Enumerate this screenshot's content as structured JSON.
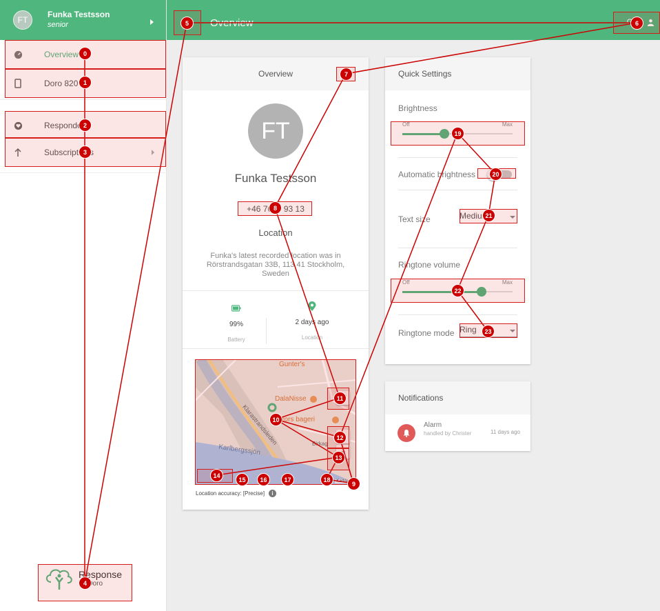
{
  "sidebar": {
    "avatar_initials": "FT",
    "user_name": "Funka Testsson",
    "user_role": "senior",
    "items": [
      {
        "label": "Overview",
        "icon": "dashboard-icon"
      },
      {
        "label": "Doro 820",
        "icon": "phone-icon"
      },
      {
        "label": "Responders",
        "icon": "heart-icon"
      },
      {
        "label": "Subscriptions",
        "icon": "arrow-up-icon"
      }
    ],
    "logo_title": "Response",
    "logo_sub": "by Doro"
  },
  "topbar": {
    "title": "Overview",
    "user_label": "Ch..."
  },
  "overview": {
    "header": "Overview",
    "initials": "FT",
    "name": "Funka Testsson",
    "phone": "+46 76 ... 93 13",
    "location_title": "Location",
    "location_text": "Funka's latest recorded location was in Rörstrandsgatan 33B, 113 41 Stockholm, Sweden",
    "battery_value": "99%",
    "battery_caption": "Battery",
    "location_value": "2 days ago",
    "location_caption": "Location",
    "map_labels": {
      "gunters": "Gunter's",
      "dalanisse": "DalaNisse",
      "bageri": "Ebrors bageri",
      "karlbergssjon": "Karlbergssjön",
      "klarastrand": "Klarastrandsleden",
      "birka": "Birkag",
      "kart": "Kartdata"
    },
    "location_accuracy": "Location accuracy: [Precise]"
  },
  "quick_settings": {
    "header": "Quick Settings",
    "brightness_label": "Brightness",
    "brightness_min": "Off",
    "brightness_max": "Max",
    "brightness_level": 0.38,
    "auto_brightness_label": "Automatic brightness",
    "text_size_label": "Text size",
    "text_size_value": "Medium",
    "ringtone_volume_label": "Ringtone volume",
    "ringtone_min": "Off",
    "ringtone_max": "Max",
    "ringtone_level": 0.72,
    "ringtone_mode_label": "Ringtone mode",
    "ringtone_mode_value": "Ring"
  },
  "notifications": {
    "header": "Notifications",
    "items": [
      {
        "title": "Alarm",
        "subtitle": "handled by Christer",
        "time": "11 days ago"
      }
    ]
  },
  "badges": [
    "0",
    "1",
    "2",
    "3",
    "4",
    "5",
    "6",
    "7",
    "8",
    "9",
    "10",
    "11",
    "12",
    "13",
    "14",
    "15",
    "16",
    "17",
    "18",
    "19",
    "20",
    "21",
    "22",
    "23"
  ],
  "colors": {
    "brand_green": "#4fb67e",
    "annotation_red": "#cc0000",
    "alarm_red": "#e05a5a"
  }
}
